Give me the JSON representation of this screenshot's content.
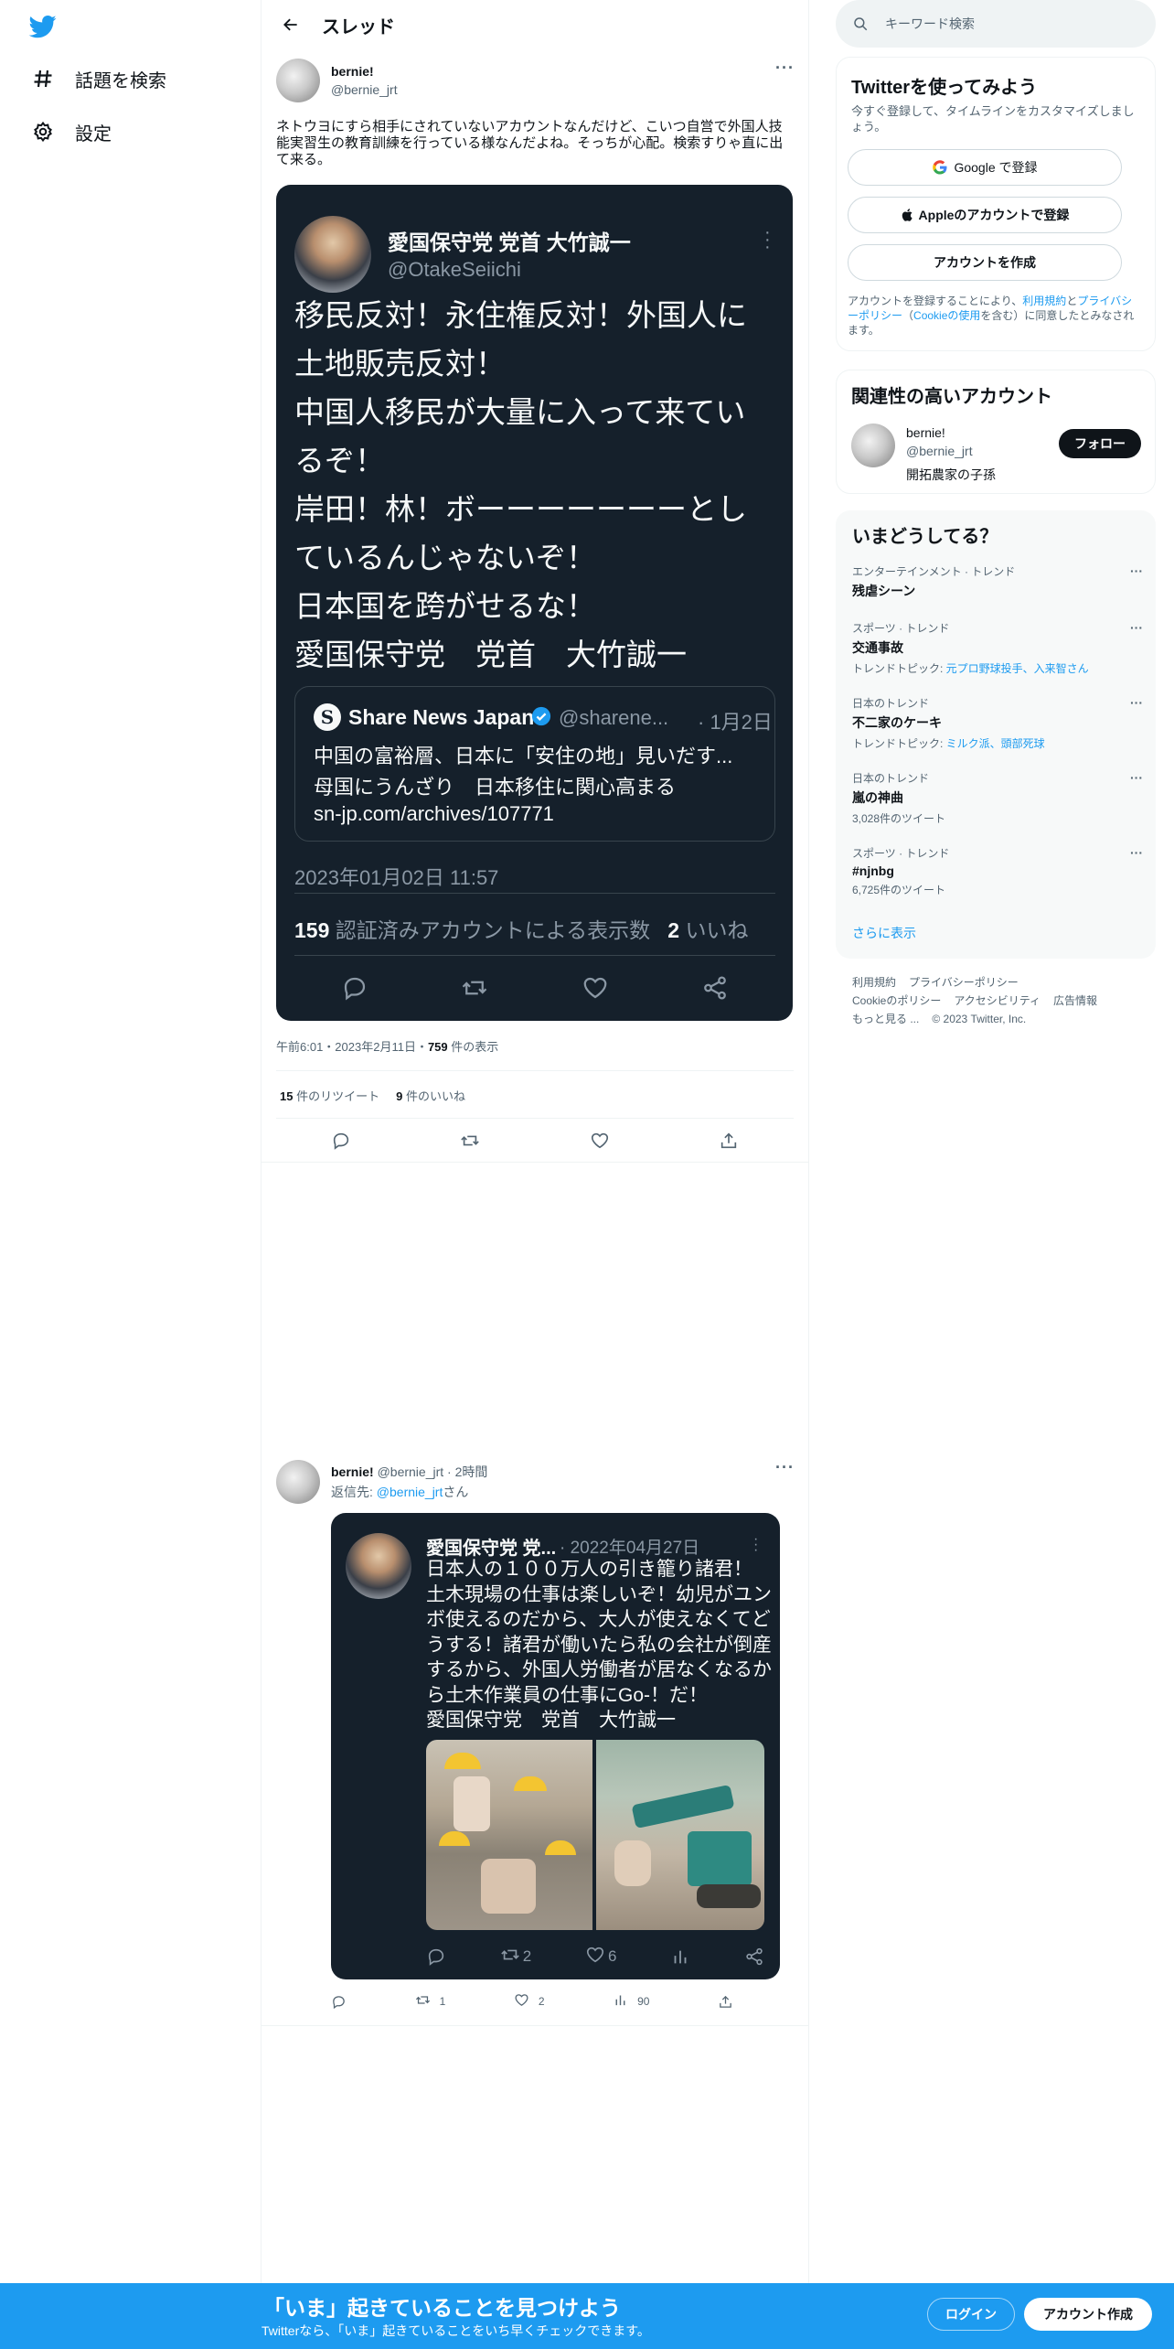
{
  "nav": {
    "explore": "話題を検索",
    "settings": "設定"
  },
  "header": {
    "title": "スレッド"
  },
  "tweet": {
    "name": "bernie!",
    "handle": "@bernie_jrt",
    "text": "ネトウヨにすら相手にされていないアカウントなんだけど、こいつ自営で外国人技能実習生の教育訓練を行っている様なんだよね。そっちが心配。検索すりゃ直に出て来る。",
    "time_line": "午前6:01・2023年2月11日・",
    "views_num": "759",
    "views_label": " 件の表示",
    "rt_num": "15",
    "rt_label": " 件のリツイート",
    "like_num": "9",
    "like_label": " 件のいいね"
  },
  "embed1": {
    "name": "愛国保守党 党首 大竹誠一",
    "handle": "@OtakeSeiichi",
    "lines": [
      "移民反対！永住権反対！外国人に",
      "土地販売反対！",
      "中国人移民が大量に入って来てい",
      "るぞ！",
      "岸田！林！ボーーーーーーーとし",
      "ているんじゃないぞ！",
      "日本国を跨がせるな！",
      "愛国保守党　党首　大竹誠一"
    ],
    "quote": {
      "logo": "S",
      "name": "Share News Japan",
      "handle": "@sharene...",
      "date": "· 1月2日",
      "line1": "中国の富裕層、日本に「安住の地」見いだす...",
      "line2": "母国にうんざり　日本移住に関心高まる",
      "line3": "sn-jp.com/archives/107771"
    },
    "timestamp": "2023年01月02日 11:57",
    "views_num": "159",
    "views_label": "認証済みアカウントによる表示数",
    "likes_num": "2",
    "likes_label": "いいね"
  },
  "reply": {
    "name": "bernie!",
    "meta": "@bernie_jrt · 2時間",
    "reply_to_label": "返信先: ",
    "reply_to_handle": "@bernie_jrt",
    "reply_to_suffix": "さん",
    "rt": "1",
    "likes": "2",
    "views": "90"
  },
  "embed2": {
    "name": "愛国保守党 党...",
    "date": "· 2022年04月27日",
    "lines": [
      "日本人の１００万人の引き籠り諸君！",
      "土木現場の仕事は楽しいぞ！幼児がユン",
      "ボ使えるのだから、大人が使えなくてど",
      "うする！諸君が働いたら私の会社が倒産",
      "するから、外国人労働者が居なくなるか",
      "ら土木作業員の仕事にGo-！だ！",
      "愛国保守党　党首　大竹誠一"
    ],
    "rt": "2",
    "likes": "6"
  },
  "sidebar": {
    "search_placeholder": "キーワード検索",
    "signup": {
      "title": "Twitterを使ってみよう",
      "sub": "今すぐ登録して、タイムラインをカスタマイズしましょう。",
      "google": "Google で登録",
      "apple": "Appleのアカウントで登録",
      "create": "アカウントを作成",
      "legal_pre": "アカウントを登録することにより、",
      "legal_terms": "利用規約",
      "legal_and": "と",
      "legal_privacy": "プライバシーポリシー",
      "legal_open": "（",
      "legal_cookie": "Cookieの使用",
      "legal_post": "を含む）に同意したとみなされます。"
    },
    "related": {
      "title": "関連性の高いアカウント",
      "name": "bernie!",
      "handle": "@bernie_jrt",
      "bio": "開拓農家の子孫",
      "follow": "フォロー"
    },
    "trends": {
      "title": "いまどうしてる？",
      "items": [
        {
          "cat": "エンターテインメント · トレンド",
          "name": "残虐シーン",
          "sub": "",
          "links": ""
        },
        {
          "cat": "スポーツ · トレンド",
          "name": "交通事故",
          "sub": "トレンドトピック: ",
          "links": "元プロ野球投手、入来智さん"
        },
        {
          "cat": "日本のトレンド",
          "name": "不二家のケーキ",
          "sub": "トレンドトピック: ",
          "links": "ミルク派、頭部死球"
        },
        {
          "cat": "日本のトレンド",
          "name": "嵐の神曲",
          "sub": "3,028件のツイート",
          "links": ""
        },
        {
          "cat": "スポーツ · トレンド",
          "name": "#njnbg",
          "sub": "6,725件のツイート",
          "links": ""
        }
      ],
      "more": "さらに表示"
    },
    "footer": {
      "l1a": "利用規約",
      "l1b": "プライバシーポリシー",
      "l2a": "Cookieのポリシー",
      "l2b": "アクセシビリティ",
      "l2c": "広告情報",
      "l3a": "もっと見る ...",
      "l3b": "© 2023 Twitter, Inc."
    }
  },
  "bottom": {
    "title": "「いま」起きていることを見つけよう",
    "sub": "Twitterなら、「いま」起きていることをいち早くチェックできます。",
    "login": "ログイン",
    "signup": "アカウント作成"
  },
  "colors": {
    "accent": "#1d9bf0",
    "dark_card": "#15202b"
  }
}
